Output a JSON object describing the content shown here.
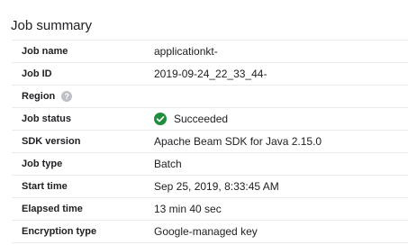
{
  "section": {
    "title": "Job summary"
  },
  "rows": [
    {
      "label": "Job name",
      "value": "applicationkt-"
    },
    {
      "label": "Job ID",
      "value": "2019-09-24_22_33_44-"
    },
    {
      "label": "Region",
      "value": ""
    },
    {
      "label": "Job status",
      "value": "Succeeded"
    },
    {
      "label": "SDK version",
      "value": "Apache Beam SDK for Java 2.15.0"
    },
    {
      "label": "Job type",
      "value": "Batch"
    },
    {
      "label": "Start time",
      "value": "Sep 25, 2019, 8:33:45 AM"
    },
    {
      "label": "Elapsed time",
      "value": "13 min 40 sec"
    },
    {
      "label": "Encryption type",
      "value": "Google-managed key"
    }
  ],
  "icons": {
    "region_help": "help-icon",
    "status": "check-circle-icon"
  },
  "colors": {
    "success": "#1e8e3e",
    "help": "#bdc1c6",
    "divider": "#e8eaed"
  }
}
